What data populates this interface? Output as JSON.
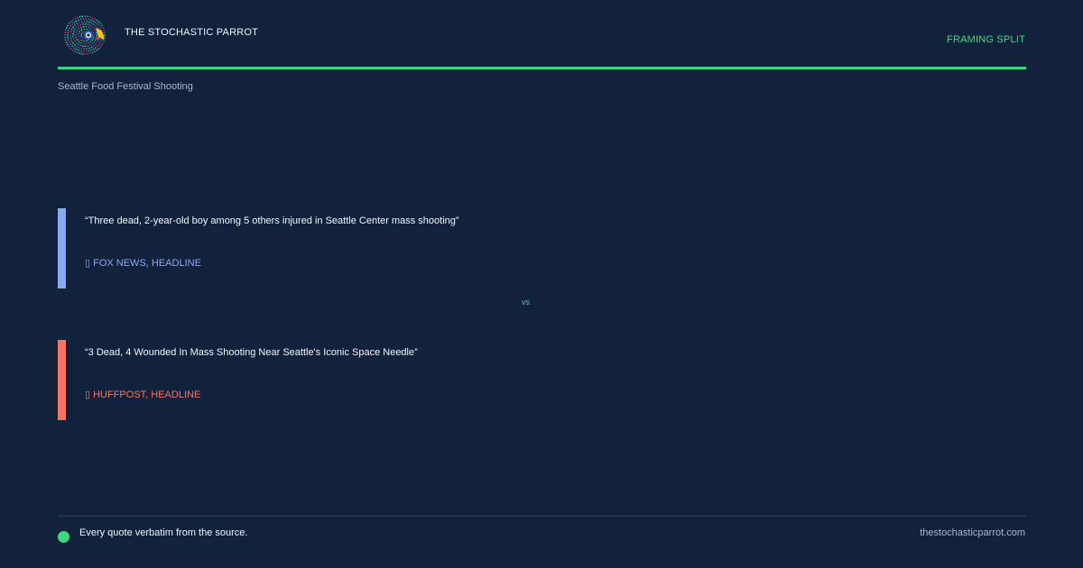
{
  "header": {
    "logo_icon": "parrot-icon",
    "brand": "THE STOCHASTIC PARROT",
    "badge": "FRAMING SPLIT"
  },
  "topic": "Seattle Food Festival Shooting",
  "quotes": [
    {
      "text": "“Three dead, 2-year-old boy among 5 others injured in Seattle Center mass shooting”",
      "source": "▯ FOX NEWS, HEADLINE",
      "color": "#8aaaf0"
    },
    {
      "text": "“3 Dead, 4 Wounded In Mass Shooting Near Seattle's Iconic Space Needle”",
      "source": "▯ HUFFPOST, HEADLINE",
      "color": "#f07565"
    }
  ],
  "separator": "vs",
  "footer": {
    "note": "Every quote verbatim from the source.",
    "site": "thestochasticparrot.com"
  },
  "colors": {
    "background": "#12223d",
    "accent": "#3fd683"
  }
}
